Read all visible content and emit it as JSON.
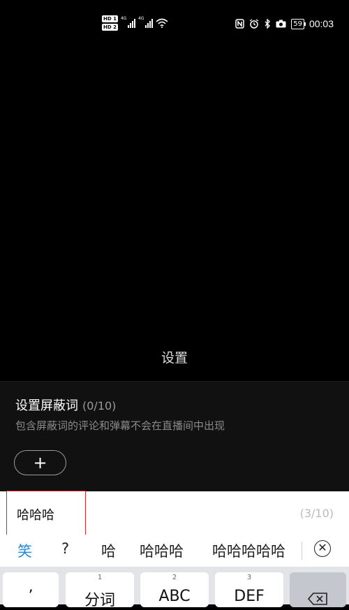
{
  "status_bar": {
    "hd1": "HD 1",
    "hd2": "HD 2",
    "net1": "4G",
    "net2": "4G",
    "battery": "59",
    "time": "00:03"
  },
  "panel": {
    "header": "设置",
    "title": "设置屏蔽词",
    "count": "(0/10)",
    "description": "包含屏蔽词的评论和弹幕不会在直播间中出现",
    "add_label": "+"
  },
  "input": {
    "value": "哈哈哈",
    "counter": "(3/10)"
  },
  "candidates": [
    "笑",
    "?",
    "哈",
    "哈哈哈",
    "哈哈哈哈哈"
  ],
  "keyboard": {
    "keys": [
      {
        "num": "",
        "label": "’"
      },
      {
        "num": "1",
        "label": "分词"
      },
      {
        "num": "2",
        "label": "ABC"
      },
      {
        "num": "3",
        "label": "DEF"
      }
    ]
  },
  "colors": {
    "accent": "#1c8ad8",
    "highlight": "#d9262b"
  }
}
